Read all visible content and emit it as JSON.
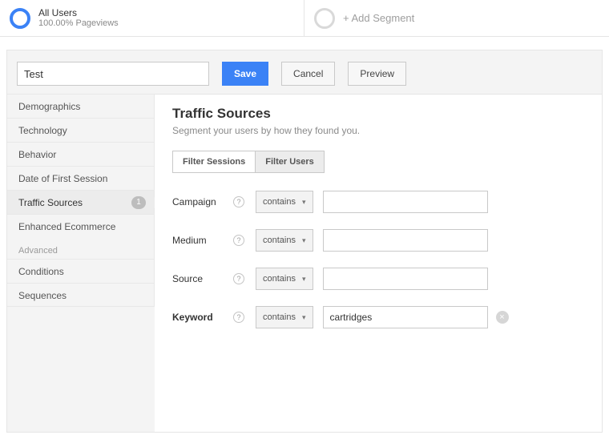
{
  "segments": {
    "primary": {
      "title": "All Users",
      "subtitle": "100.00% Pageviews"
    },
    "add_label": "+ Add Segment"
  },
  "actions": {
    "name_value": "Test",
    "save": "Save",
    "cancel": "Cancel",
    "preview": "Preview"
  },
  "sidebar": {
    "items": [
      {
        "label": "Demographics"
      },
      {
        "label": "Technology"
      },
      {
        "label": "Behavior"
      },
      {
        "label": "Date of First Session"
      },
      {
        "label": "Traffic Sources",
        "active": true,
        "count": "1"
      },
      {
        "label": "Enhanced Ecommerce"
      }
    ],
    "advanced_label": "Advanced",
    "advanced": [
      {
        "label": "Conditions"
      },
      {
        "label": "Sequences"
      }
    ]
  },
  "panel": {
    "title": "Traffic Sources",
    "subtitle": "Segment your users by how they found you.",
    "tabs": {
      "sessions": "Filter Sessions",
      "users": "Filter Users"
    },
    "rows": [
      {
        "label": "Campaign",
        "op": "contains",
        "value": "",
        "bold": false
      },
      {
        "label": "Medium",
        "op": "contains",
        "value": "",
        "bold": false
      },
      {
        "label": "Source",
        "op": "contains",
        "value": "",
        "bold": false
      },
      {
        "label": "Keyword",
        "op": "contains",
        "value": "cartridges",
        "bold": true,
        "clearable": true
      }
    ]
  }
}
